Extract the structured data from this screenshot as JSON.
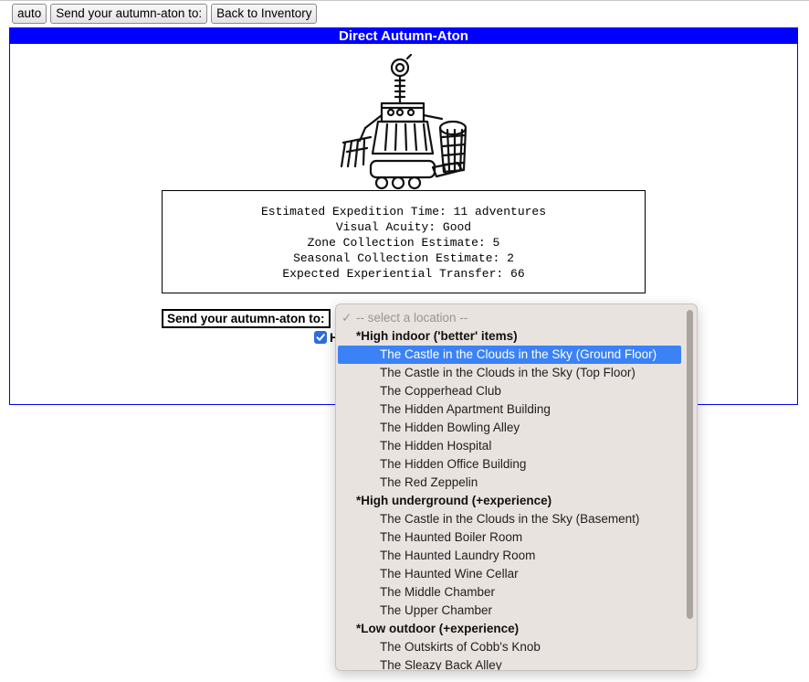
{
  "toolbar": {
    "auto_label": "auto",
    "send_label": "Send your autumn-aton to:",
    "back_label": "Back to Inventory"
  },
  "panel": {
    "title": "Direct Autumn-Aton",
    "stats": [
      "Estimated Expedition Time: 11 adventures",
      "Visual Acuity: Good",
      "Zone Collection Estimate: 5",
      "Seasonal Collection Estimate: 2",
      "Expected Experiential Transfer: 66"
    ],
    "send_label": "Send your autumn-aton to:",
    "checkbox_label_partial": "H",
    "checkbox_checked": true
  },
  "dropdown": {
    "placeholder": "-- select a location --",
    "selected_option": "The Castle in the Clouds in the Sky (Ground Floor)",
    "rows": [
      {
        "type": "placeholder",
        "text": "-- select a location --"
      },
      {
        "type": "group",
        "text": "*High indoor ('better' items)"
      },
      {
        "type": "option",
        "text": "The Castle in the Clouds in the Sky (Ground Floor)",
        "selected": true
      },
      {
        "type": "option",
        "text": "The Castle in the Clouds in the Sky (Top Floor)"
      },
      {
        "type": "option",
        "text": "The Copperhead Club"
      },
      {
        "type": "option",
        "text": "The Hidden Apartment Building"
      },
      {
        "type": "option",
        "text": "The Hidden Bowling Alley"
      },
      {
        "type": "option",
        "text": "The Hidden Hospital"
      },
      {
        "type": "option",
        "text": "The Hidden Office Building"
      },
      {
        "type": "option",
        "text": "The Red Zeppelin"
      },
      {
        "type": "group",
        "text": "*High underground (+experience)"
      },
      {
        "type": "option",
        "text": "The Castle in the Clouds in the Sky (Basement)"
      },
      {
        "type": "option",
        "text": "The Haunted Boiler Room"
      },
      {
        "type": "option",
        "text": "The Haunted Laundry Room"
      },
      {
        "type": "option",
        "text": "The Haunted Wine Cellar"
      },
      {
        "type": "option",
        "text": "The Middle Chamber"
      },
      {
        "type": "option",
        "text": "The Upper Chamber"
      },
      {
        "type": "group",
        "text": "*Low outdoor (+experience)"
      },
      {
        "type": "option",
        "text": "The Outskirts of Cobb's Knob"
      },
      {
        "type": "option",
        "text": "The Sleazy Back Alley"
      }
    ]
  },
  "colors": {
    "panel_border": "#0000ff",
    "header_bg": "#0000ff",
    "selected_bg": "#3b82f6",
    "dropdown_bg": "#e9e3df"
  },
  "icons": {
    "robot": "autumn-aton-robot-icon",
    "check": "checkmark-icon"
  }
}
